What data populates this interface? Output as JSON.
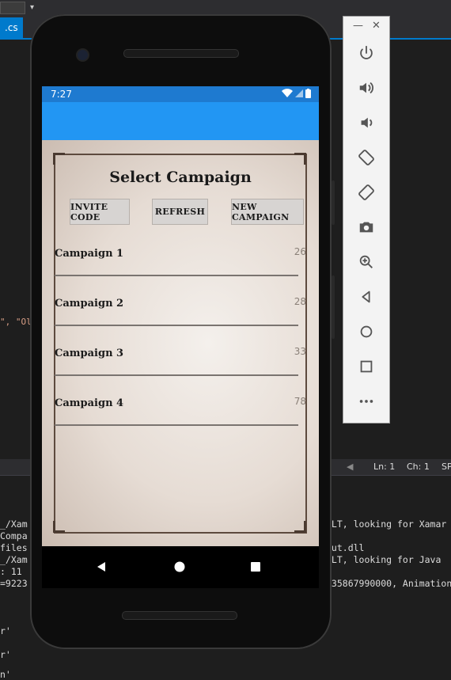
{
  "ide": {
    "tab_label": ".cs",
    "code_fragment": "\", \"Ol",
    "status": {
      "ln": "Ln: 1",
      "ch": "Ch: 1",
      "sp": "SP"
    },
    "output_left": [
      "_/Xam",
      "Compa",
      "files",
      "_/Xam",
      ": 11",
      "=9223",
      "",
      "",
      "r'",
      "",
      "r'",
      "",
      "n'"
    ],
    "output_right": [
      "ULT, looking for Xamar",
      "",
      "out.dll",
      "ULT, looking for Java",
      "",
      "335867990000, Animation"
    ]
  },
  "emulator_toolbar": {
    "minimize_glyph": "—",
    "close_glyph": "✕",
    "icons": [
      "power-icon",
      "volume-up-icon",
      "volume-down-icon",
      "rotate-left-icon",
      "rotate-right-icon",
      "camera-icon",
      "zoom-icon",
      "back-icon",
      "home-icon",
      "overview-icon",
      "more-icon"
    ]
  },
  "phone": {
    "status_bar": {
      "time": "7:27"
    },
    "app": {
      "title": "Select Campaign",
      "buttons": {
        "invite_code": "Invite Code",
        "refresh": "Refresh",
        "new_campaign": "New Campaign"
      },
      "campaigns": [
        {
          "name": "Campaign 1",
          "count": "26"
        },
        {
          "name": "Campaign 2",
          "count": "28"
        },
        {
          "name": "Campaign 3",
          "count": "33"
        },
        {
          "name": "Campaign 4",
          "count": "78"
        }
      ]
    }
  },
  "colors": {
    "status_bar": "#1e7ad0",
    "app_bar": "#2296f3",
    "ide_accent": "#007acc"
  }
}
